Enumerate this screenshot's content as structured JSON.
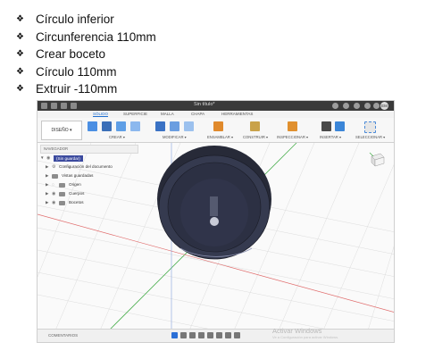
{
  "instructions": [
    "Círculo inferior",
    "Circunferencia 110mm",
    "Crear boceto",
    "Círculo 110mm",
    "Extruir -110mm"
  ],
  "bullet_glyph": "❖",
  "app": {
    "document_title": "Sin título*",
    "user_initials": "EM",
    "tabs": [
      "SÓLIDO",
      "SUPERFICIE",
      "MALLA",
      "CHAPA",
      "HERRAMIENTAS"
    ],
    "active_tab": "SÓLIDO",
    "workspace": "DISEÑO ▾",
    "groups": [
      "CREAR ▾",
      "MODIFICAR ▾",
      "ENSAMBLAR ▾",
      "CONSTRUIR ▾",
      "INSPECCIONAR ▾",
      "INSERTAR ▾",
      "SELECCIONAR ▾"
    ],
    "browser_header": "NAVEGADOR",
    "browser_root": "(Sin guardar)",
    "browser_items": [
      "Configuración del documento",
      "Vistas guardadas",
      "Origen",
      "Cuerpos",
      "Bocetos"
    ],
    "comments_label": "COMENTARIOS",
    "watermark_title": "Activar Windows",
    "watermark_sub": "Ve a Configuración para activar Windows."
  },
  "colors": {
    "accent": "#1e6fd1",
    "cylinder": "#2e3242",
    "titlebar": "#3a3a3a"
  }
}
